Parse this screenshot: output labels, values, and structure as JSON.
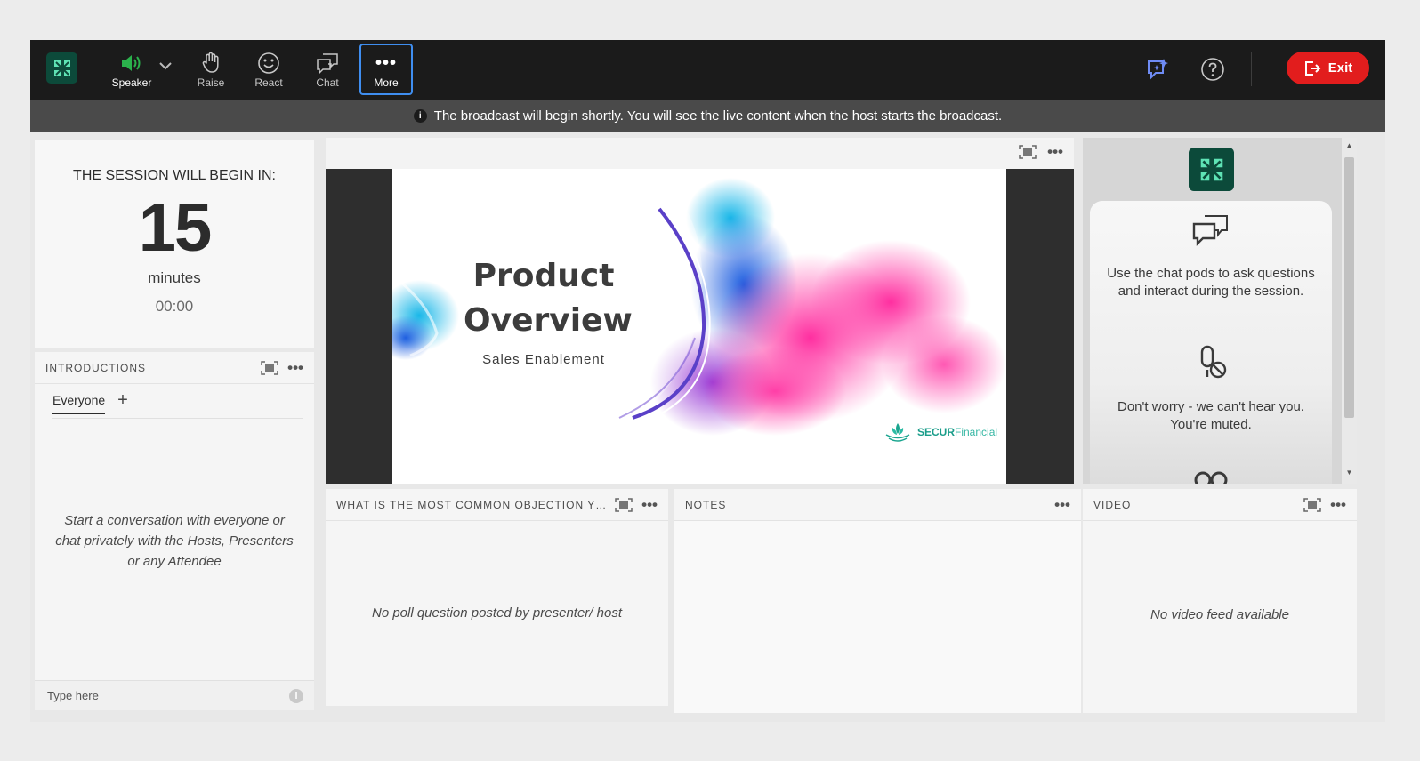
{
  "toolbar": {
    "speaker_label": "Speaker",
    "raise_label": "Raise",
    "react_label": "React",
    "chat_label": "Chat",
    "more_label": "More",
    "exit_label": "Exit",
    "colors": {
      "speaker_green": "#2bb24c",
      "exit_red": "#e21d1d",
      "more_outline": "#3f8ef0",
      "ai_icon": "#6f8cf5"
    }
  },
  "banner": {
    "message": "The broadcast will begin shortly. You will see the live content when the host starts the broadcast.",
    "icon": "info-icon"
  },
  "countdown": {
    "heading": "THE SESSION WILL BEGIN IN:",
    "value": "15",
    "unit": "minutes",
    "time": "00:00"
  },
  "introductions": {
    "title": "INTRODUCTIONS",
    "tab": "Everyone",
    "empty_message": "Start a conversation with everyone or chat privately with the Hosts, Presenters or any Attendee",
    "input_placeholder": "Type here"
  },
  "slide": {
    "title_line1": "Product",
    "title_line2": "Overview",
    "subtitle": "Sales Enablement",
    "brand_bold": "SECUR",
    "brand_light": "Financial"
  },
  "help": {
    "chat_tip": "Use the chat pods to ask questions and interact during the session.",
    "muted_tip": "Don't worry - we can't hear you. You're muted."
  },
  "poll": {
    "title": "WHAT IS THE MOST COMMON OBJECTION YOU...",
    "empty_message": "No poll question posted by presenter/ host"
  },
  "notes": {
    "title": "NOTES"
  },
  "video": {
    "title": "VIDEO",
    "empty_message": "No video feed available"
  }
}
